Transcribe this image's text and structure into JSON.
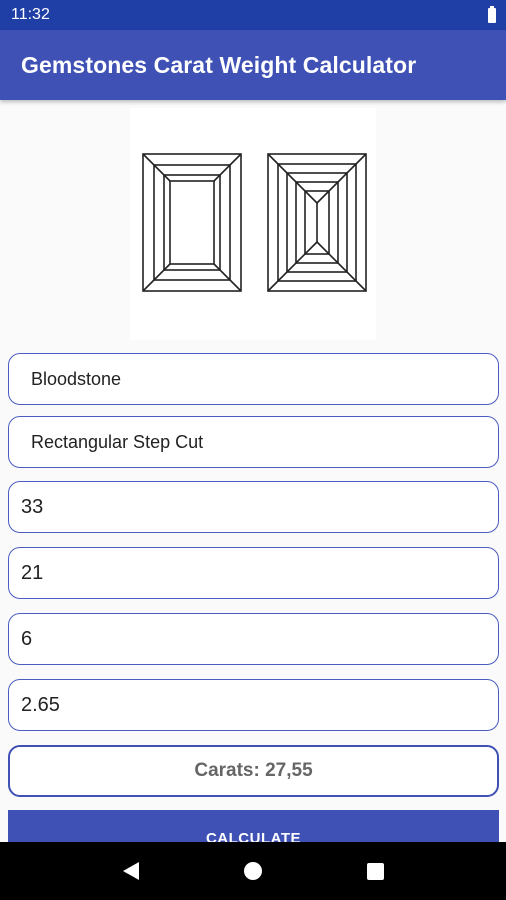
{
  "status_bar": {
    "time": "11:32"
  },
  "app_bar": {
    "title": "Gemstones Carat Weight Calculator"
  },
  "illustration": {
    "icon": "rectangular-step-cut-diagram"
  },
  "form": {
    "gemstone": "Bloodstone",
    "cut": "Rectangular Step Cut",
    "length": "33",
    "width": "21",
    "depth": "6",
    "specific_gravity": "2.65",
    "result": "Carats: 27,55"
  },
  "button": {
    "label": "CALCULATE"
  },
  "colors": {
    "primary": "#3f51b5",
    "status_bar": "#1f3fa6",
    "background": "#fafafa"
  }
}
